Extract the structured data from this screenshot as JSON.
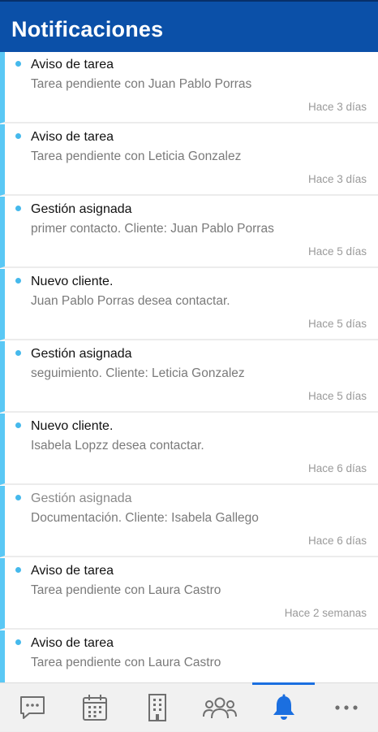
{
  "header": {
    "title": "Notificaciones"
  },
  "notifications": [
    {
      "title": "Aviso de tarea",
      "text": "Tarea pendiente con Juan Pablo Porras",
      "time": "Hace 3 días"
    },
    {
      "title": "Aviso de tarea",
      "text": "Tarea pendiente con Leticia Gonzalez",
      "time": "Hace 3 días"
    },
    {
      "title": "Gestión asignada",
      "text": "primer contacto. Cliente: Juan Pablo Porras",
      "time": "Hace 5 días"
    },
    {
      "title": "Nuevo cliente.",
      "text": "Juan Pablo Porras desea contactar.",
      "time": "Hace 5 días"
    },
    {
      "title": "Gestión asignada",
      "text": "seguimiento. Cliente: Leticia Gonzalez",
      "time": "Hace 5 días"
    },
    {
      "title": "Nuevo cliente.",
      "text": "Isabela Lopzz desea contactar.",
      "time": "Hace 6 días"
    },
    {
      "title": "Gestión asignada",
      "text": "Documentación. Cliente: Isabela Gallego",
      "time": "Hace 6 días",
      "read": true
    },
    {
      "title": "Aviso de tarea",
      "text": "Tarea pendiente con Laura Castro",
      "time": "Hace 2 semanas"
    },
    {
      "title": "Aviso de tarea",
      "text": "Tarea pendiente con Laura Castro",
      "time": ""
    }
  ],
  "tabbar": {
    "active": "notifications",
    "active_color": "#1b6fe0",
    "icon_color": "#6f6f6f",
    "tabs": [
      {
        "id": "messages",
        "icon": "chat-icon"
      },
      {
        "id": "calendar",
        "icon": "calendar-icon"
      },
      {
        "id": "companies",
        "icon": "building-icon"
      },
      {
        "id": "contacts",
        "icon": "people-icon"
      },
      {
        "id": "notifications",
        "icon": "bell-icon"
      },
      {
        "id": "more",
        "icon": "more-icon"
      }
    ]
  },
  "colors": {
    "appbar": "#0b50a8",
    "unread_accent": "#5ac8f5"
  }
}
